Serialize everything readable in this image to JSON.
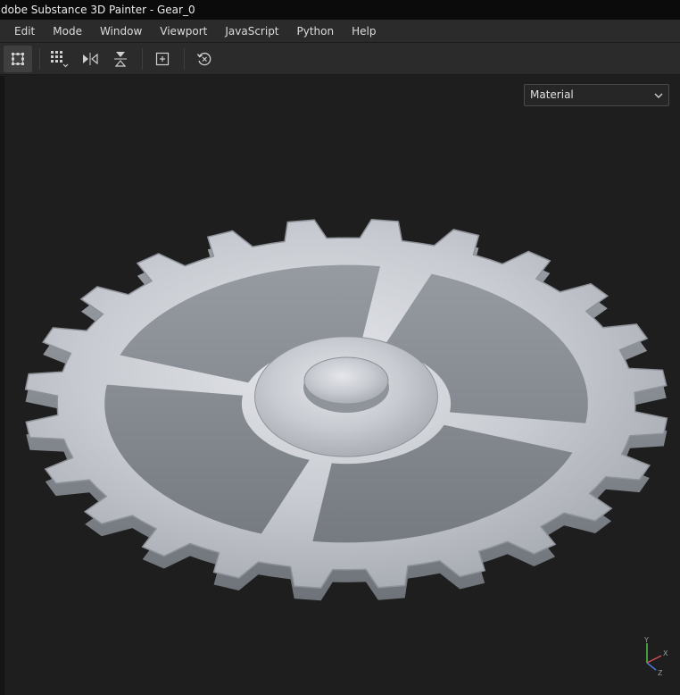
{
  "window": {
    "title": "dobe Substance 3D Painter - Gear_0"
  },
  "menu": {
    "items": [
      "Edit",
      "Mode",
      "Window",
      "Viewport",
      "JavaScript",
      "Python",
      "Help"
    ]
  },
  "toolbar": {
    "buttons": [
      {
        "icon": "selection-grid-icon",
        "active": true
      },
      {
        "icon": "grid-dropdown-icon",
        "active": false
      },
      {
        "icon": "mirror-horizontal-icon",
        "active": false
      },
      {
        "icon": "mirror-vertical-icon",
        "active": false
      },
      {
        "icon": "frame-add-icon",
        "active": false
      },
      {
        "icon": "reset-history-icon",
        "active": false
      }
    ]
  },
  "viewport": {
    "display_mode": {
      "selected": "Material"
    },
    "axis_labels": {
      "x": "X",
      "y": "Y",
      "z": "Z"
    },
    "colors": {
      "background": "#1e1e1e",
      "axis_x": "#d05050",
      "axis_y": "#50c050",
      "axis_z": "#4a7ad8"
    }
  }
}
